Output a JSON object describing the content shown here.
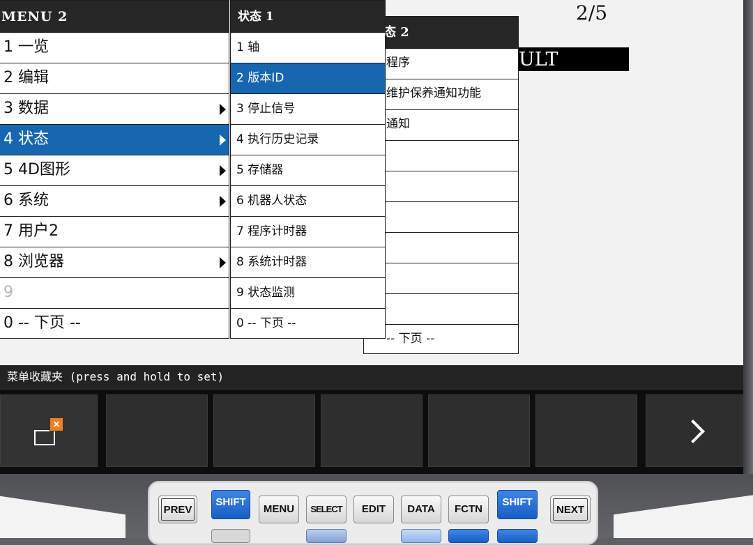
{
  "page_indicator": "2/5",
  "fault_text": "ULT",
  "menu1": {
    "header": "MENU  2",
    "items": [
      {
        "label": "1 一览",
        "submenu": false,
        "selected": false,
        "disabled": false
      },
      {
        "label": "2 编辑",
        "submenu": false,
        "selected": false,
        "disabled": false
      },
      {
        "label": "3 数据",
        "submenu": true,
        "selected": false,
        "disabled": false
      },
      {
        "label": "4 状态",
        "submenu": true,
        "selected": true,
        "disabled": false
      },
      {
        "label": "5 4D图形",
        "submenu": true,
        "selected": false,
        "disabled": false
      },
      {
        "label": "6 系统",
        "submenu": true,
        "selected": false,
        "disabled": false
      },
      {
        "label": "7 用户2",
        "submenu": false,
        "selected": false,
        "disabled": false
      },
      {
        "label": "8 浏览器",
        "submenu": true,
        "selected": false,
        "disabled": false
      },
      {
        "label": "9",
        "submenu": false,
        "selected": false,
        "disabled": true
      },
      {
        "label": "0 -- 下页 --",
        "submenu": false,
        "selected": false,
        "disabled": false
      }
    ]
  },
  "menu2": {
    "header": "状态  1",
    "items": [
      {
        "label": "1 轴",
        "selected": false
      },
      {
        "label": "2 版本ID",
        "selected": true
      },
      {
        "label": "3 停止信号",
        "selected": false
      },
      {
        "label": "4 执行历史记录",
        "selected": false
      },
      {
        "label": "5 存储器",
        "selected": false
      },
      {
        "label": "6 机器人状态",
        "selected": false
      },
      {
        "label": "7 程序计时器",
        "selected": false
      },
      {
        "label": "8 系统计时器",
        "selected": false
      },
      {
        "label": "9 状态监测",
        "selected": false
      },
      {
        "label": "0 -- 下页 --",
        "selected": false
      }
    ]
  },
  "menu3": {
    "header": "态  2",
    "items": [
      {
        "label": "程序"
      },
      {
        "label": "维护保养通知功能"
      },
      {
        "label": "通知"
      },
      {
        "label": ""
      },
      {
        "label": ""
      },
      {
        "label": ""
      },
      {
        "label": ""
      },
      {
        "label": ""
      },
      {
        "label": ""
      },
      {
        "label": "-- 下页 --"
      }
    ]
  },
  "status_line": "菜单收藏夹 (press and hold to set)",
  "softkeys": {
    "first_icon": "window-close-icon",
    "last_icon": "chevron-right-icon",
    "x_badge": "×"
  },
  "hardware_keys": [
    {
      "label": "PREV",
      "style": "outlined"
    },
    {
      "label": "SHIFT",
      "style": "blue"
    },
    {
      "label": "MENU",
      "style": "plain"
    },
    {
      "label": "SELECT",
      "style": "plain"
    },
    {
      "label": "EDIT",
      "style": "plain"
    },
    {
      "label": "DATA",
      "style": "plain"
    },
    {
      "label": "FCTN",
      "style": "plain"
    },
    {
      "label": "SHIFT",
      "style": "blue"
    },
    {
      "label": "NEXT",
      "style": "outlined"
    }
  ]
}
